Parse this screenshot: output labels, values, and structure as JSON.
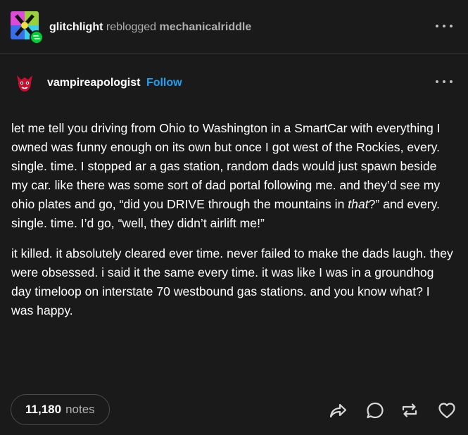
{
  "reblog": {
    "user": "glitchlight",
    "verb": "reblogged",
    "source_user": "mechanicalriddle"
  },
  "post": {
    "author": "vampireapologist",
    "follow_label": "Follow",
    "paragraph1_before": "let me tell you driving from Ohio to Washington in a SmartCar with everything I owned was funny enough on its own but once I got west of the Rockies, every. single. time. I stopped ar a gas station, random dads would just spawn beside my car. like there was some sort of dad portal following me. and they’d see my ohio plates and go, “did you DRIVE through the mountains in ",
    "paragraph1_italic": "that",
    "paragraph1_after": "?” and every. single. time. I’d go, “well, they didn’t airlift me!”",
    "paragraph2": "it killed. it absolutely cleared ever time. never failed to make the dads laugh. they were obsessed. i said it the same every time. it was like I was in a groundhog day timeloop on interstate 70 westbound gas stations. and you know what? I was happy."
  },
  "footer": {
    "notes_count": "11,180",
    "notes_label": "notes"
  },
  "icons": {
    "more": "more-horizontal-icon",
    "share": "share-arrow-icon",
    "reply": "reply-bubble-icon",
    "reblog": "reblog-icon",
    "like": "heart-icon",
    "reblog_badge": "reblog-badge-icon"
  },
  "colors": {
    "background": "#1a1a1a",
    "follow": "#1da1f2",
    "reblog_badge": "#00cf35",
    "muted_text": "#b0b0b0"
  }
}
